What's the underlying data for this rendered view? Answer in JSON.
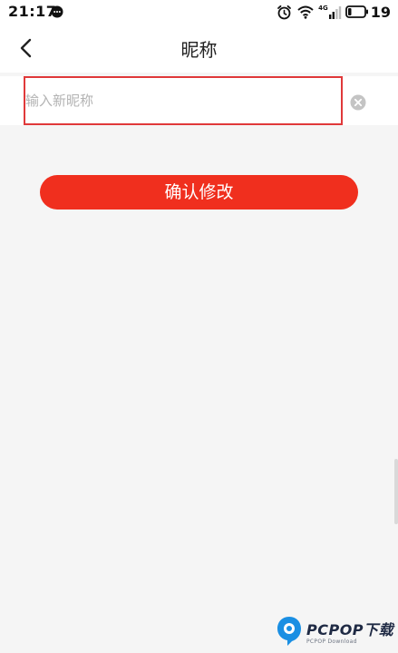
{
  "status_bar": {
    "time": "21:17",
    "network_label": "4G",
    "battery_level": "19"
  },
  "nav": {
    "title": "昵称"
  },
  "nickname_input": {
    "value": "",
    "placeholder": "输入新昵称"
  },
  "confirm_button": {
    "label": "确认修改"
  },
  "watermark": {
    "brand": "PCPOP下载",
    "sub": "PCPOP Download"
  },
  "colors": {
    "accent": "#f02f1e",
    "highlight_border": "#e0393a",
    "background": "#f5f5f5"
  },
  "icons": [
    "chat-icon",
    "alarm-icon",
    "wifi-icon",
    "signal-icon",
    "battery-icon",
    "back-arrow-icon",
    "clear-icon",
    "pcpop-logo-icon"
  ]
}
